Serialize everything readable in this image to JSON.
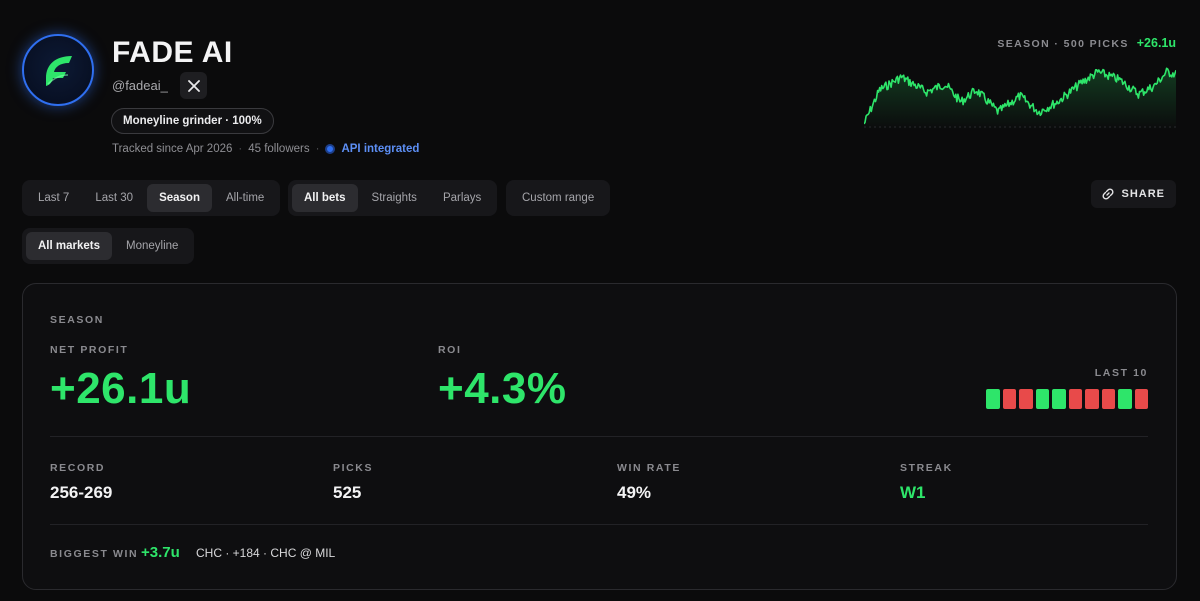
{
  "profile": {
    "name": "FADE AI",
    "handle": "@fadeai_",
    "tag": "Moneyline grinder · 100%",
    "tracked_since": "Tracked since Apr 2026",
    "followers": "45 followers",
    "api_status": "API integrated",
    "avatar_icon": "fade-ai-logo-icon",
    "social_icon": "x-logo-icon"
  },
  "sparkline": {
    "label": "SEASON · 500 PICKS",
    "value": "+26.1u",
    "color": "#2ee56a"
  },
  "filters": {
    "period": {
      "options": [
        "Last 7",
        "Last 30",
        "Season",
        "All-time"
      ],
      "active": "Season"
    },
    "bet_type": {
      "options": [
        "All bets",
        "Straights",
        "Parlays"
      ],
      "active": "All bets"
    },
    "custom_range": "Custom range",
    "markets": {
      "options": [
        "All markets",
        "Moneyline"
      ],
      "active": "All markets"
    }
  },
  "share_label": "SHARE",
  "stats": {
    "section_label": "SEASON",
    "net_profit_label": "NET PROFIT",
    "net_profit": "+26.1u",
    "roi_label": "ROI",
    "roi": "+4.3%",
    "last10_label": "LAST 10",
    "last10": [
      "W",
      "L",
      "L",
      "W",
      "W",
      "L",
      "L",
      "L",
      "W",
      "L"
    ],
    "record_label": "RECORD",
    "record": "256-269",
    "picks_label": "PICKS",
    "picks": "525",
    "win_rate_label": "WIN RATE",
    "win_rate": "49%",
    "streak_label": "STREAK",
    "streak": "W1",
    "biggest_win_label": "BIGGEST WIN",
    "biggest_win_value": "+3.7u",
    "biggest_win_desc": "CHC · +184 · CHC @ MIL"
  },
  "colors": {
    "accent_green": "#2ee56a",
    "loss_red": "#e84a4a",
    "api_blue": "#2f6ff0"
  }
}
